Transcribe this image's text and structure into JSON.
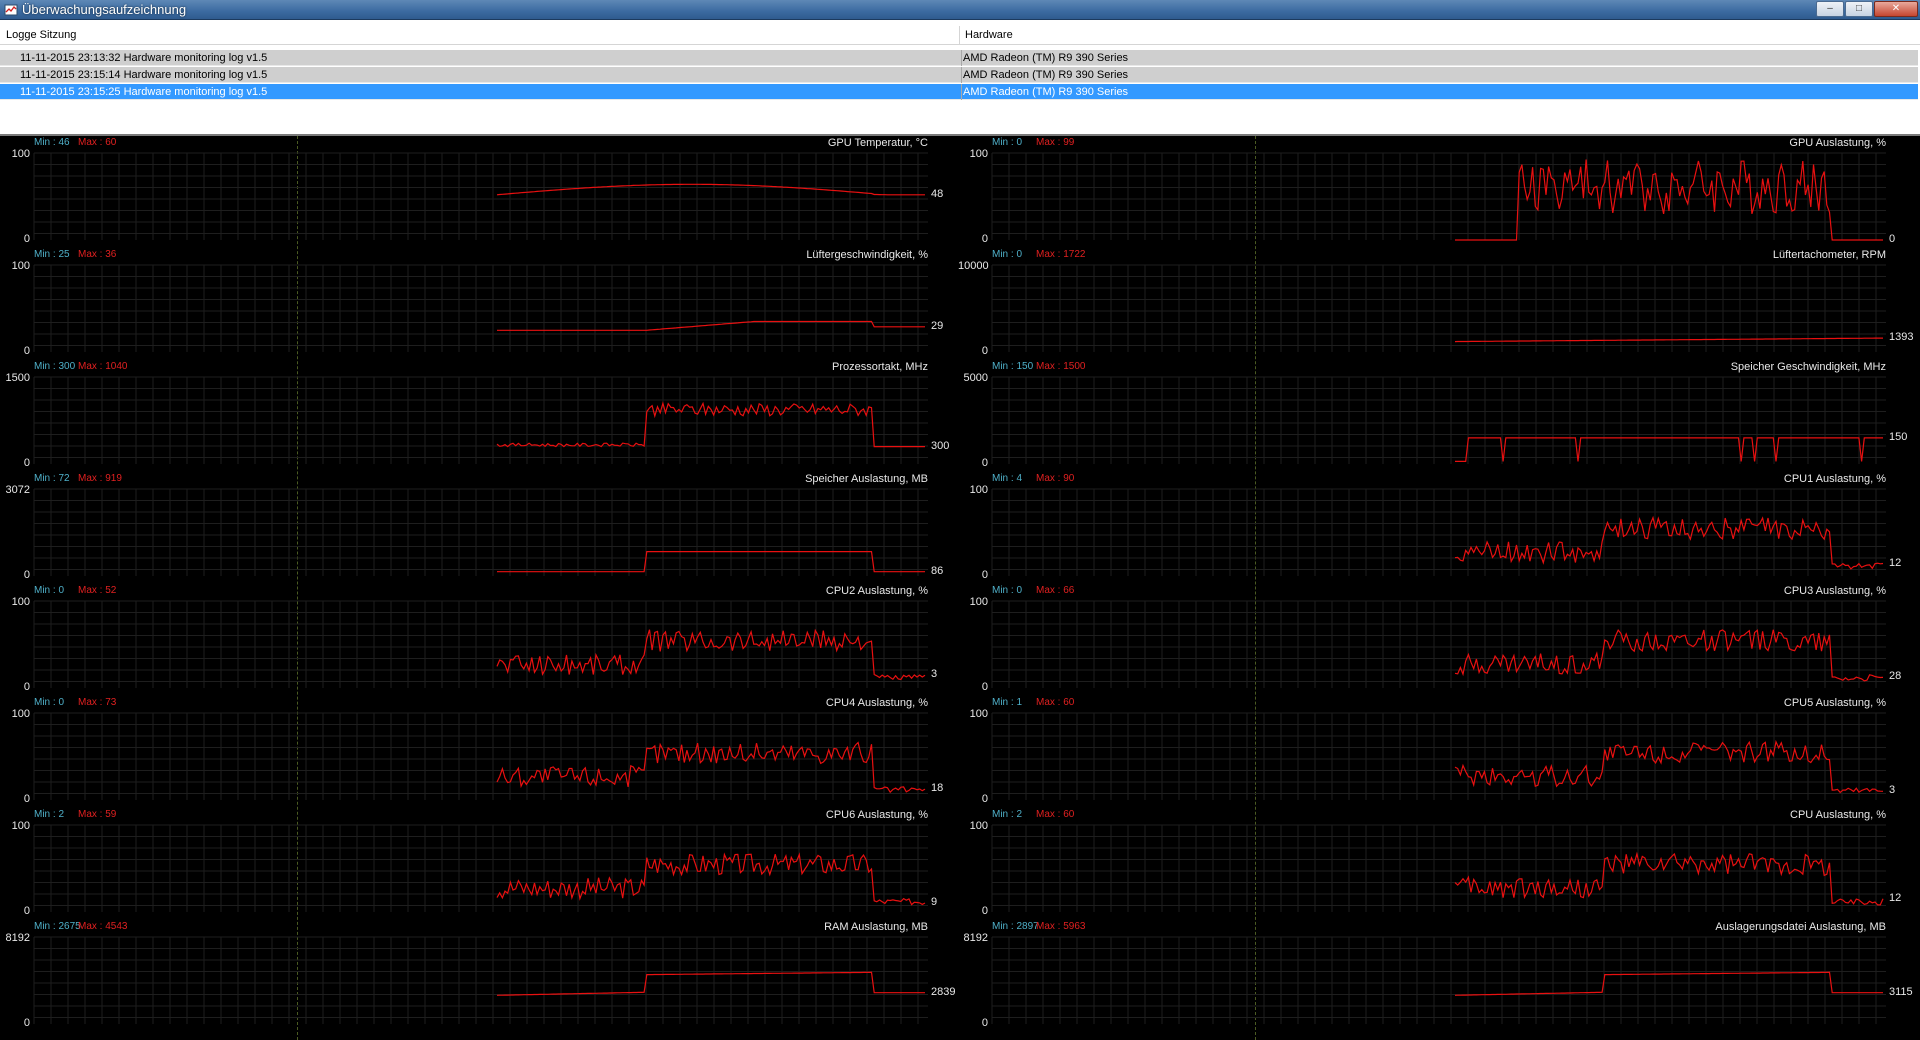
{
  "window": {
    "title": "Überwachungsaufzeichnung",
    "buttons": {
      "minimize": "–",
      "maximize": "□",
      "close": "✕"
    }
  },
  "session_list": {
    "columns": [
      "Logge Sitzung",
      "Hardware"
    ],
    "rows": [
      {
        "session": "11-11-2015 23:13:32 Hardware monitoring log v1.5",
        "hardware": "AMD Radeon (TM) R9 390 Series",
        "selected": false
      },
      {
        "session": "11-11-2015 23:15:14 Hardware monitoring log v1.5",
        "hardware": "AMD Radeon (TM) R9 390 Series",
        "selected": false
      },
      {
        "session": "11-11-2015 23:15:25 Hardware monitoring log v1.5",
        "hardware": "AMD Radeon (TM) R9 390 Series",
        "selected": true
      }
    ]
  },
  "colors": {
    "line": "#e81010",
    "min_text": "#4fb0c9",
    "max_text": "#e02020",
    "grid": "#1e1e1e",
    "selection": "#3399ff"
  },
  "graphs": {
    "left": [
      {
        "title": "GPU Temperatur, °C",
        "min": "Min : 46",
        "max": "Max : 60",
        "ymax": "100",
        "ymin": "0",
        "current": "48"
      },
      {
        "title": "Lüftergeschwindigkeit, %",
        "min": "Min : 25",
        "max": "Max : 36",
        "ymax": "100",
        "ymin": "0",
        "current": "29"
      },
      {
        "title": "Prozessortakt, MHz",
        "min": "Min : 300",
        "max": "Max : 1040",
        "ymax": "1500",
        "ymin": "0",
        "current": "300"
      },
      {
        "title": "Speicher Auslastung, MB",
        "min": "Min : 72",
        "max": "Max : 919",
        "ymax": "3072",
        "ymin": "0",
        "current": "86"
      },
      {
        "title": "CPU2 Auslastung, %",
        "min": "Min : 0",
        "max": "Max : 52",
        "ymax": "100",
        "ymin": "0",
        "current": "3"
      },
      {
        "title": "CPU4 Auslastung, %",
        "min": "Min : 0",
        "max": "Max : 73",
        "ymax": "100",
        "ymin": "0",
        "current": "18"
      },
      {
        "title": "CPU6 Auslastung, %",
        "min": "Min : 2",
        "max": "Max : 59",
        "ymax": "100",
        "ymin": "0",
        "current": "9"
      },
      {
        "title": "RAM Auslastung, MB",
        "min": "Min : 2675",
        "max": "Max : 4543",
        "ymax": "8192",
        "ymin": "0",
        "current": "2839"
      }
    ],
    "right": [
      {
        "title": "GPU Auslastung, %",
        "min": "Min : 0",
        "max": "Max : 99",
        "ymax": "100",
        "ymin": "0",
        "current": "0"
      },
      {
        "title": "Lüftertachometer, RPM",
        "min": "Min : 0",
        "max": "Max : 1722",
        "ymax": "10000",
        "ymin": "0",
        "current": "1393"
      },
      {
        "title": "Speicher Geschwindigkeit, MHz",
        "min": "Min : 150",
        "max": "Max : 1500",
        "ymax": "5000",
        "ymin": "0",
        "current": "150"
      },
      {
        "title": "CPU1 Auslastung, %",
        "min": "Min : 4",
        "max": "Max : 90",
        "ymax": "100",
        "ymin": "0",
        "current": "12"
      },
      {
        "title": "CPU3 Auslastung, %",
        "min": "Min : 0",
        "max": "Max : 66",
        "ymax": "100",
        "ymin": "0",
        "current": "28"
      },
      {
        "title": "CPU5 Auslastung, %",
        "min": "Min : 1",
        "max": "Max : 60",
        "ymax": "100",
        "ymin": "0",
        "current": "3"
      },
      {
        "title": "CPU Auslastung, %",
        "min": "Min : 2",
        "max": "Max : 60",
        "ymax": "100",
        "ymin": "0",
        "current": "12"
      },
      {
        "title": "Auslagerungsdatei Auslastung, MB",
        "min": "Min : 2897",
        "max": "Max : 5963",
        "ymax": "8192",
        "ymin": "0",
        "current": "3115"
      }
    ]
  }
}
